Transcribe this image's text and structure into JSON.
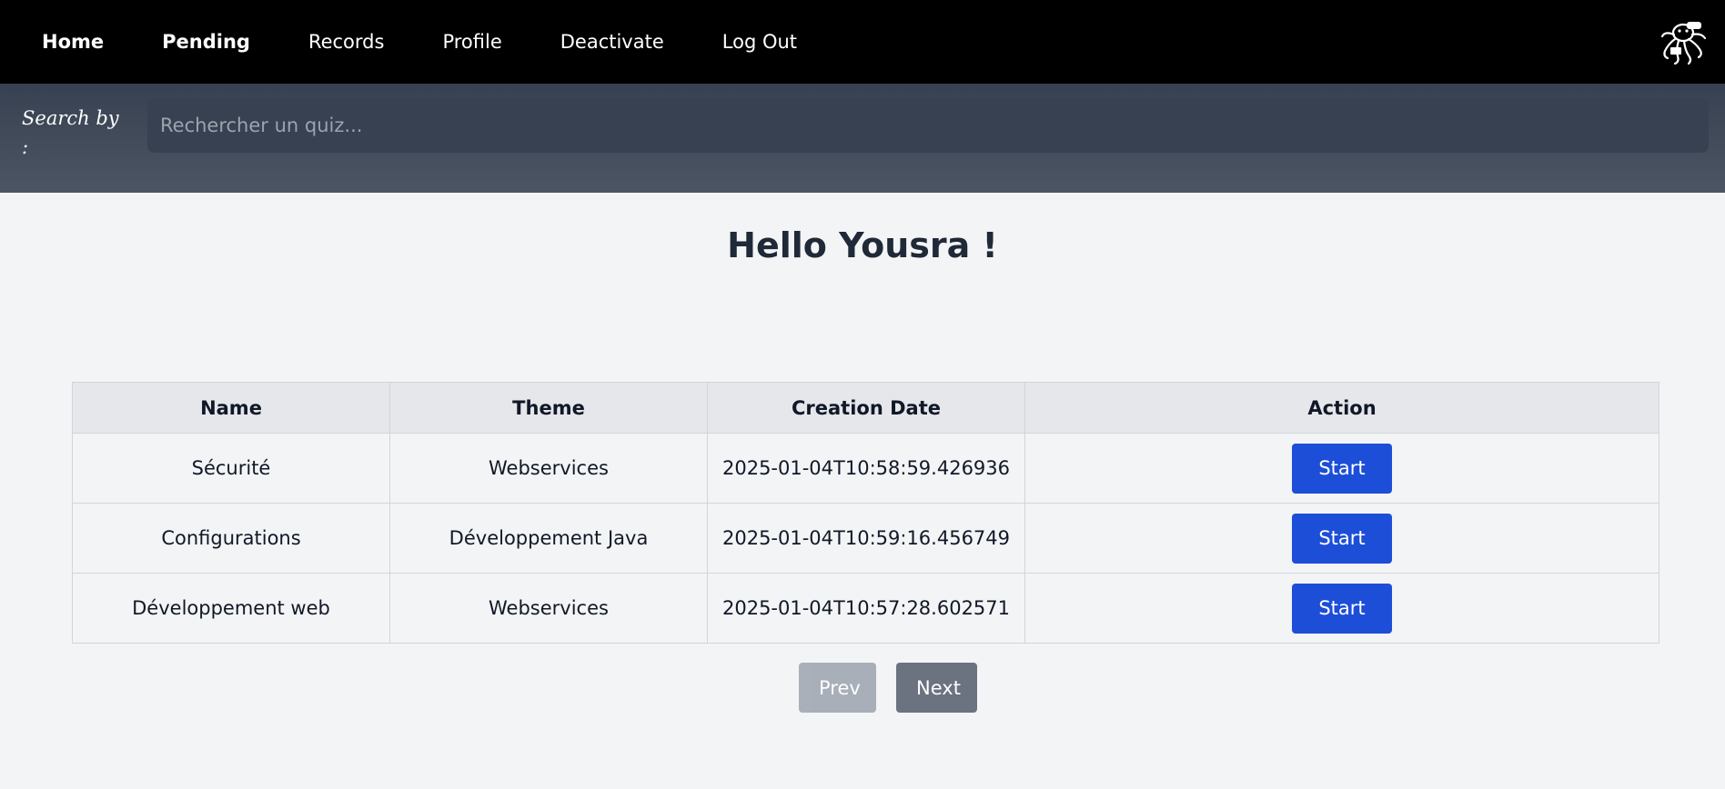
{
  "nav": {
    "links": [
      {
        "label": "Home",
        "bold": true
      },
      {
        "label": "Pending",
        "bold": true
      },
      {
        "label": "Records",
        "bold": false
      },
      {
        "label": "Profile",
        "bold": false
      },
      {
        "label": "Deactivate",
        "bold": false
      },
      {
        "label": "Log Out",
        "bold": false
      }
    ]
  },
  "search": {
    "label": "Search by :",
    "placeholder": "Rechercher un quiz...",
    "value": ""
  },
  "main": {
    "greeting": "Hello Yousra !"
  },
  "table": {
    "headers": [
      "Name",
      "Theme",
      "Creation Date",
      "Action"
    ],
    "rows": [
      {
        "name": "Sécurité",
        "theme": "Webservices",
        "date": "2025-01-04T10:58:59.426936",
        "action": "Start"
      },
      {
        "name": "Configurations",
        "theme": "Développement Java",
        "date": "2025-01-04T10:59:16.456749",
        "action": "Start"
      },
      {
        "name": "Développement web",
        "theme": "Webservices",
        "date": "2025-01-04T10:57:28.602571",
        "action": "Start"
      }
    ]
  },
  "pagination": {
    "prev_label": "Prev",
    "next_label": "Next"
  },
  "colors": {
    "nav_bg": "#000000",
    "search_bg": "#4b5563",
    "primary_button": "#1d4ed8",
    "prev_disabled": "#9ca3af",
    "next": "#6b7280"
  }
}
